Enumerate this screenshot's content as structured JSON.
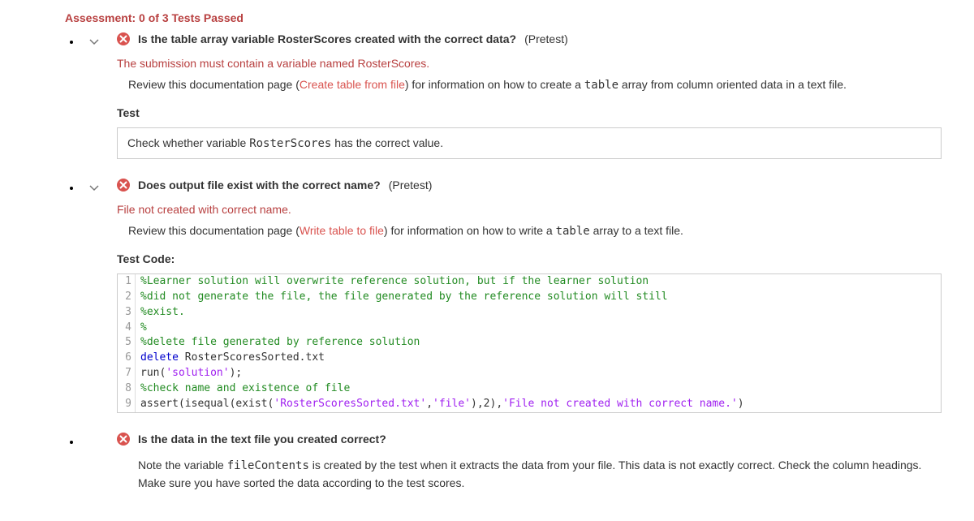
{
  "assessment_header": "Assessment: 0 of 3 Tests Passed",
  "tests": [
    {
      "title": "Is the table array variable RosterScores created with the correct data?",
      "pretest": "(Pretest)",
      "error": "The submission must contain a variable named RosterScores.",
      "review_prefix": "Review this documentation page (",
      "review_link": "Create table from file",
      "review_suffix_a": ") for information on how to create a ",
      "review_code": "table",
      "review_suffix_b": " array from column oriented data in a text file.",
      "section_label": "Test",
      "box_text_a": "Check whether variable ",
      "box_text_code": "RosterScores",
      "box_text_b": " has the correct value."
    },
    {
      "title": "Does output file exist with the correct name?",
      "pretest": "(Pretest)",
      "error": "File not created with correct name.",
      "review_prefix": "Review this documentation page (",
      "review_link": "Write table to file",
      "review_suffix_a": ") for information on how to write a ",
      "review_code": "table",
      "review_suffix_b": " array to a text file.",
      "section_label": "Test Code:",
      "code": {
        "l1": "%Learner solution will overwrite reference solution, but if the learner solution",
        "l2": "%did not generate the file, the file generated by the reference solution will still",
        "l3": "%exist.",
        "l4": "%",
        "l5": "%delete file generated by reference solution",
        "l6a": "delete ",
        "l6b": "RosterScoresSorted.txt",
        "l7a": "run(",
        "l7b": "'solution'",
        "l7c": ");",
        "l8": "%check name and existence of file",
        "l9a": "assert(isequal(exist(",
        "l9b": "'RosterScoresSorted.txt'",
        "l9c": ",",
        "l9d": "'file'",
        "l9e": "),2),",
        "l9f": "'File not created with correct name.'",
        "l9g": ")"
      }
    },
    {
      "title": "Is the data in the text file you created correct?",
      "note_a": "Note the variable ",
      "note_code": "fileContents",
      "note_b": " is created by the test when it extracts the data from your file.  This data is not exactly correct.  Check the column headings.  Make sure you have sorted the data according to the test scores."
    }
  ]
}
